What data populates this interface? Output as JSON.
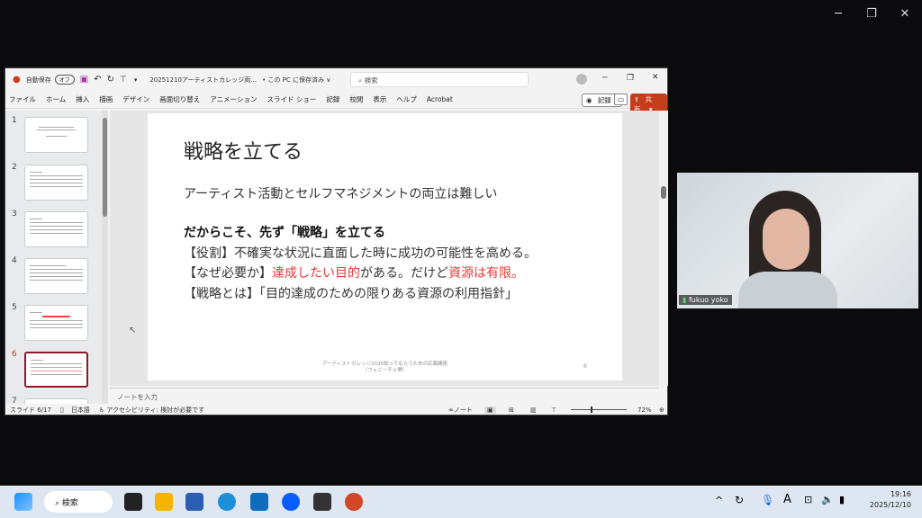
{
  "desktop": {
    "controls": [
      "minimize",
      "maximize",
      "close"
    ]
  },
  "ppt": {
    "autosave_label": "自動保存",
    "autosave_state": "オフ",
    "filename": "20251210アーティストカレッジ両…",
    "save_status": "• この PC に保存済み ∨",
    "search_placeholder": "検索",
    "tabs": [
      "ファイル",
      "ホーム",
      "挿入",
      "描画",
      "デザイン",
      "画面切り替え",
      "アニメーション",
      "スライド ショー",
      "記録",
      "校閲",
      "表示",
      "ヘルプ",
      "Acrobat"
    ],
    "record_label": "記録",
    "share_label": "共有",
    "thumb_numbers": [
      "1",
      "2",
      "3",
      "4",
      "5",
      "6",
      "7"
    ],
    "selected_slide": 6,
    "slide": {
      "title": "戦略を立てる",
      "line1": "アーティスト活動とセルフマネジメントの両立は難しい",
      "line2": "だからこそ、先ず「戦略」を立てる",
      "line3": "【役割】不確実な状況に直面した時に成功の可能性を高める。",
      "line4_a": "【なぜ必要か】",
      "line4_b": "達成したい目的",
      "line4_c": "がある。だけど",
      "line4_d": "資源は有限。",
      "line5": "【戦略とは】「目的達成のための限りある資源の利用指針」",
      "footer1": "アーティストカレッジ2025知ってもらうための応報講座",
      "footer2": "（フェニーチェ堺）",
      "page": "6"
    },
    "notes_placeholder": "ノートを入力",
    "status": {
      "slide": "スライド 6/17",
      "lang": "日本語",
      "accessibility": "アクセシビリティ: 検討が必要です",
      "notes": "ノート",
      "zoom": "72%"
    },
    "accent": "#c43e1c"
  },
  "video": {
    "name": "fukuo yoko"
  },
  "taskbar": {
    "search": "検索",
    "time": "19:16",
    "date": "2025/12/10"
  }
}
